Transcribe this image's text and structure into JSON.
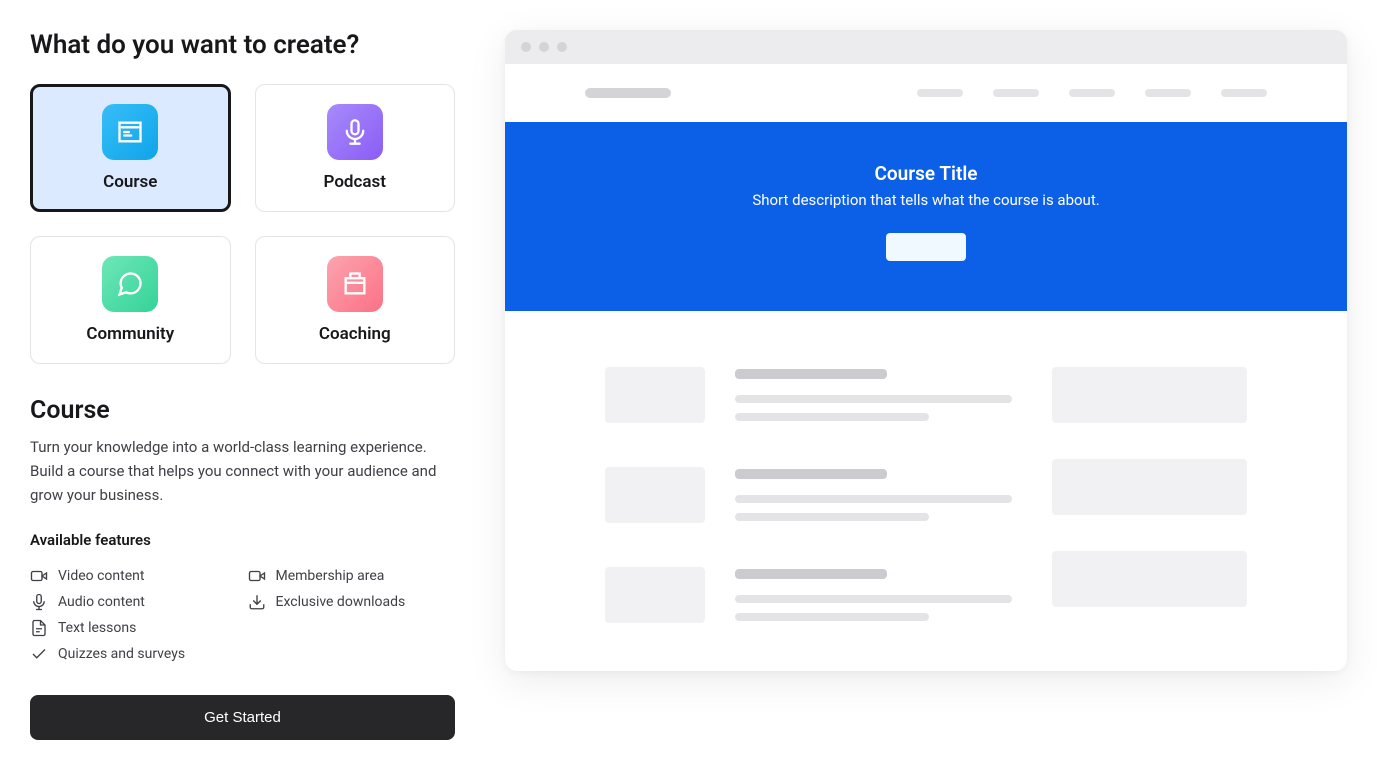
{
  "main": {
    "heading": "What do you want to create?"
  },
  "types": {
    "course": {
      "label": "Course"
    },
    "podcast": {
      "label": "Podcast"
    },
    "community": {
      "label": "Community"
    },
    "coaching": {
      "label": "Coaching"
    }
  },
  "selected": {
    "heading": "Course",
    "description": "Turn your knowledge into a world-class learning experience. Build a course that helps you connect with your audience and grow your business.",
    "features_heading": "Available features",
    "features": {
      "video": "Video content",
      "audio": "Audio content",
      "text": "Text lessons",
      "quizzes": "Quizzes and surveys",
      "membership": "Membership area",
      "downloads": "Exclusive downloads"
    }
  },
  "cta": {
    "get_started": "Get Started"
  },
  "preview": {
    "hero_title": "Course Title",
    "hero_subtitle": "Short description that tells what the course is about."
  }
}
